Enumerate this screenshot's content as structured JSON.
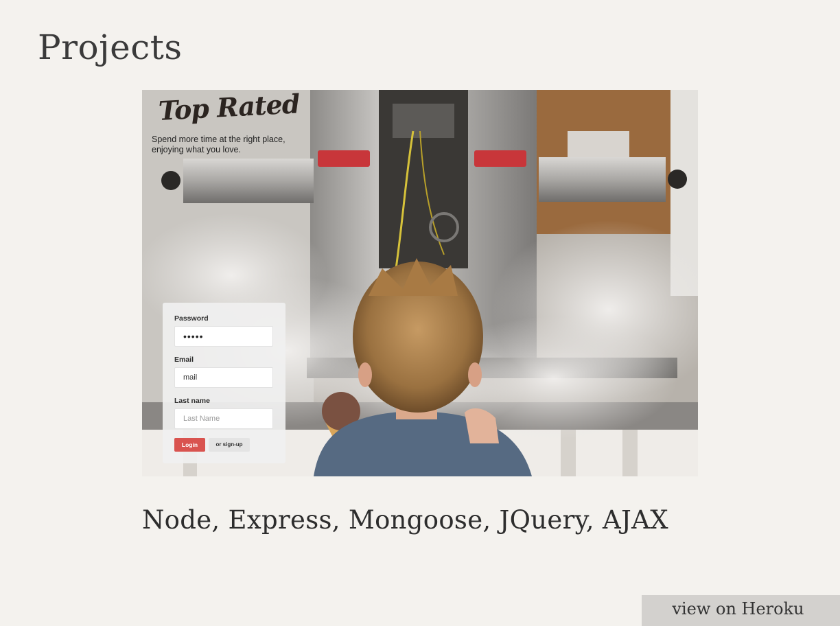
{
  "page": {
    "title": "Projects"
  },
  "project": {
    "app_logo": "Top Rated",
    "tagline": "Spend more time at the right place, enjoying what you love.",
    "form": {
      "password_label": "Password",
      "password_value": "•••••",
      "email_label": "Email",
      "email_value": "mail",
      "lastname_label": "Last name",
      "lastname_placeholder": "Last Name",
      "login_label": "Login",
      "signup_label": "or sign-up"
    },
    "tech_stack": "Node, Express, Mongoose, JQuery, AJAX",
    "link_label": "view on Heroku"
  },
  "colors": {
    "background": "#f4f2ee",
    "login_button": "#d9534f",
    "link_background": "#d3d1ce",
    "text": "#3a3a3a"
  }
}
